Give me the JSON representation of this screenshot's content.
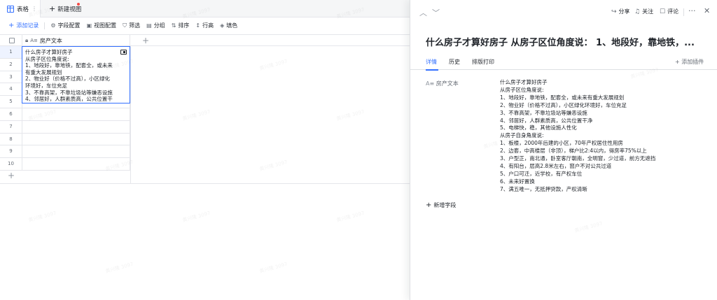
{
  "tabbar": {
    "active_tab": "表格",
    "active_tab_menu": "⋮",
    "new_view": "新建视图"
  },
  "toolbar": {
    "add_record": "添加记录",
    "field_config": "字段配置",
    "view_config": "视图配置",
    "filter": "筛选",
    "group": "分组",
    "sort": "排序",
    "row_height": "行高",
    "fill_color": "填色"
  },
  "grid": {
    "column_header": "房产文本",
    "column_type_glyph": "A≡",
    "row_numbers": [
      "1",
      "2",
      "3",
      "4",
      "5",
      "6",
      "7",
      "8",
      "9",
      "10"
    ]
  },
  "cell_editor": {
    "lines": [
      "什么房子才算好房子",
      "从房子区位角度说:",
      "1、地段好，靠地铁，配套全，或未来",
      "有重大发展规划",
      "2、物业好（价格不过高），小区绿化",
      "环境好，车位充足",
      "3、不靠高架，不靠垃圾站等嫌恶设施",
      "4、邻居好，人群素质高，公共位置干"
    ]
  },
  "panel": {
    "actions": {
      "share": "分享",
      "follow": "关注",
      "comment": "评论",
      "more": "···",
      "close": "✕"
    },
    "title": "什么房子才算好房子 从房子区位角度说： 1、地段好，靠地铁，...",
    "tabs": [
      "详情",
      "历史",
      "排版打印"
    ],
    "add_plugin": "添加插件",
    "field_label": "房产文本",
    "field_type_glyph": "A≡",
    "field_lines": [
      "什么房子才算好房子",
      "从房子区位角度说:",
      "1、地段好，靠地铁，配套全，或未来有重大发展规划",
      "2、物业好（价格不过高），小区绿化环境好，车位充足",
      "3、不靠高架，不靠垃圾站等嫌恶设施",
      "4、邻居好，人群素质高，公共位置干净",
      "5、电梯快，稳，其他设施人性化",
      "从房子自身角度说:",
      "1、板楼，2000年后建的小区，70年产权居住性用房",
      "2、边套，中高楼层（非顶），梯户比2:4以内，得房率75%以上",
      "3、户型正，南北通，卧室客厅朝南，全明窗，少过道，前方无遮挡",
      "4、有阳台，层高2.8米左右，窗户不对公共过道",
      "5、户口可迁，近学校，有产权车位",
      "6、未来好置换",
      "7、满五唯一，无抵押贷款，产权清晰"
    ],
    "add_field": "新增字段"
  },
  "watermark": "黄兴隆 3097",
  "colors": {
    "accent": "#3370ff",
    "text": "#1f2329",
    "muted": "#646a73",
    "border": "#e5e6eb",
    "new_dot": "#f54a45"
  }
}
